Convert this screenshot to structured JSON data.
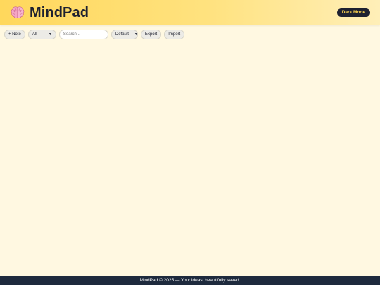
{
  "header": {
    "title": "MindPad",
    "logo_icon": "brain-icon",
    "dark_mode_label": "Dark Mode"
  },
  "toolbar": {
    "add_note_label": "+ Note",
    "filter_selected": "All",
    "search_placeholder": "Search...",
    "sort_selected": "Default",
    "export_label": "Export",
    "import_label": "Import"
  },
  "footer": {
    "text": "MindPad © 2025 — Your ideas, beautifully saved."
  },
  "colors": {
    "background": "#fff8e1",
    "header_accent": "#ffd85c",
    "dark_button": "#1e2130",
    "dark_button_text": "#ffd54f",
    "footer": "#1e2a3d"
  }
}
